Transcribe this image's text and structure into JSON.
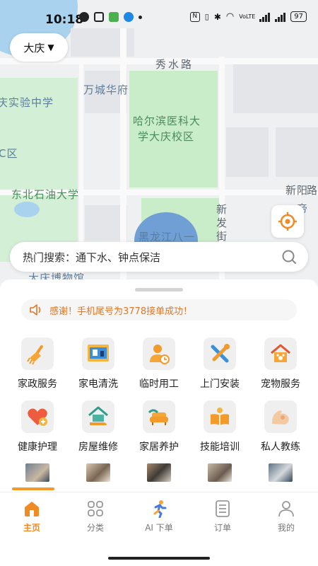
{
  "status_bar": {
    "time": "10:18",
    "network_label": "VoLTE",
    "battery": "97"
  },
  "city_selector": {
    "label": "大庆",
    "caret": "▼"
  },
  "map": {
    "labels": {
      "xiushui_road": "秀水路",
      "wancheng_huafu": "万城华府",
      "hospital": "哈尔滨医科大学大庆校区",
      "hospital_line1": "哈尔滨医科大",
      "hospital_line2": "学大庆校区",
      "shiyan_school": "庆实验中学",
      "c_district": "C区",
      "petroleum_univ": "东北石油大学",
      "xinyang": "新阳路",
      "xinyang_main": "新阳",
      "xinyang_cut": "路",
      "xinfa_street": "新发街",
      "diwang_cut": "帝",
      "heilongjiang": "黑龙江八一",
      "museum": "大庆博物馆"
    }
  },
  "search": {
    "text": "热门搜索：通下水、钟点保洁"
  },
  "notice": {
    "text": "感谢！手机尾号为3778接单成功！"
  },
  "services": [
    {
      "name": "家政服务",
      "icon": "broom-icon"
    },
    {
      "name": "家电清洗",
      "icon": "appliance-cleaning-icon"
    },
    {
      "name": "临时用工",
      "icon": "temp-worker-icon"
    },
    {
      "name": "上门安装",
      "icon": "tools-icon"
    },
    {
      "name": "宠物服务",
      "icon": "pet-house-icon"
    },
    {
      "name": "健康护理",
      "icon": "heart-plus-icon"
    },
    {
      "name": "房屋维修",
      "icon": "house-repair-icon"
    },
    {
      "name": "家居养护",
      "icon": "sofa-care-icon"
    },
    {
      "name": "技能培训",
      "icon": "book-training-icon"
    },
    {
      "name": "私人教练",
      "icon": "muscle-arm-icon"
    }
  ],
  "tabs": [
    {
      "label": "主页",
      "icon": "home-icon",
      "active": true
    },
    {
      "label": "分类",
      "icon": "category-grid-icon",
      "active": false
    },
    {
      "label": "AI 下单",
      "icon": "runner-icon",
      "active": false
    },
    {
      "label": "订单",
      "icon": "order-list-icon",
      "active": false
    },
    {
      "label": "我的",
      "icon": "profile-icon",
      "active": false
    }
  ],
  "colors": {
    "accent": "#f08a24",
    "notice_text": "#e0772b",
    "map_park": "#c9ecc9",
    "map_label": "#5b7d9c"
  }
}
